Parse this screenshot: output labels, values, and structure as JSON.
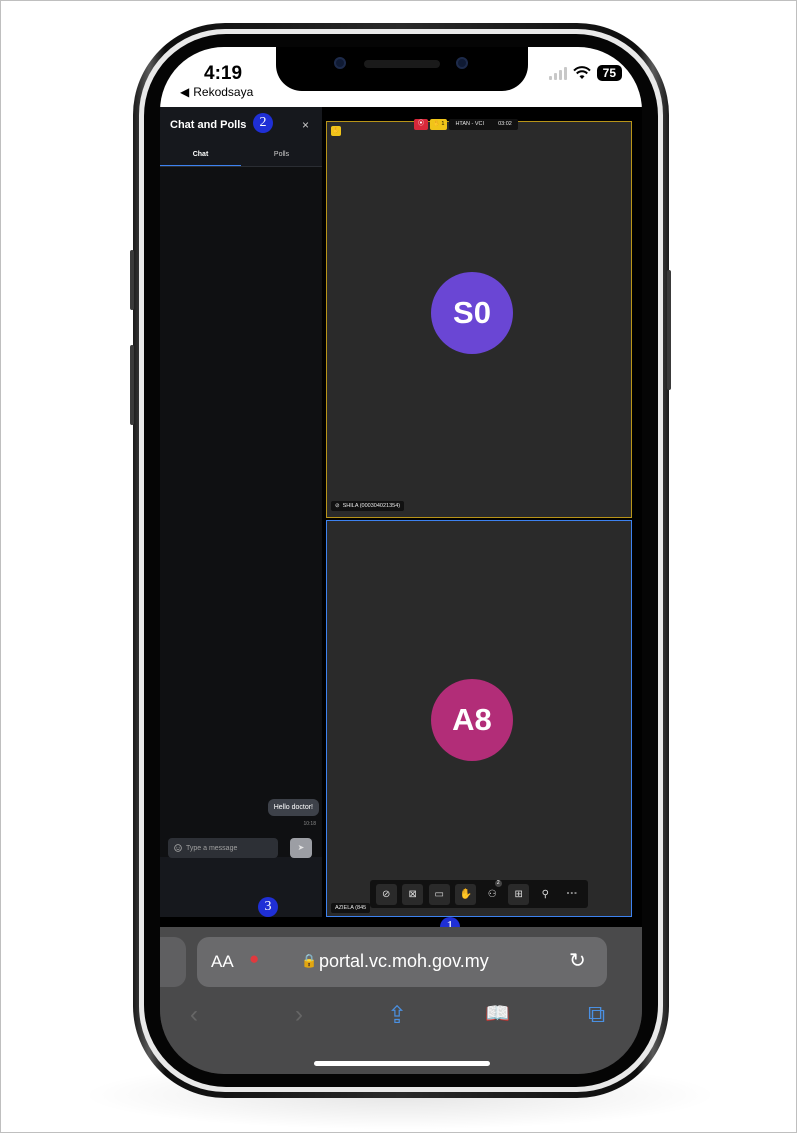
{
  "status_bar": {
    "time": "4:19",
    "back_label": "Rekodsaya",
    "back_arrow": "◀",
    "battery": "75"
  },
  "chat_panel": {
    "title": "Chat and Polls",
    "close_symbol": "×",
    "tabs": [
      {
        "label": "Chat",
        "active": true
      },
      {
        "label": "Polls",
        "active": false
      }
    ],
    "messages": [
      {
        "text": "Hello doctor!",
        "time": "10:18"
      }
    ],
    "input_placeholder": "Type a message",
    "send_symbol": "➤"
  },
  "meeting": {
    "rec_symbol": "⦿",
    "hand_count": "✋ 1",
    "meeting_name": "HTAN - VCI",
    "duration": "03:02",
    "participants": [
      {
        "initials": "S0",
        "name": "SHILA (000304021354)",
        "avatar_color": "#6a46d4",
        "hand_raised": true,
        "muted": true
      },
      {
        "initials": "A8",
        "name": "AZIELA (845",
        "avatar_color": "#b22d78",
        "hand_raised": false,
        "muted": false
      }
    ],
    "participant_count": "2"
  },
  "toolbar": {
    "items": [
      {
        "icon": "mic-off-icon",
        "glyph": "⊘",
        "highlighted": true
      },
      {
        "icon": "camera-off-icon",
        "glyph": "⊠",
        "highlighted": true
      },
      {
        "icon": "chat-icon",
        "glyph": "▭",
        "highlighted": true
      },
      {
        "icon": "raise-hand-icon",
        "glyph": "✋",
        "highlighted": true
      },
      {
        "icon": "participants-icon",
        "glyph": "⚇",
        "highlighted": false
      },
      {
        "icon": "layout-grid-icon",
        "glyph": "⊞",
        "highlighted": true
      },
      {
        "icon": "invite-icon",
        "glyph": "⚲",
        "highlighted": false
      },
      {
        "icon": "more-icon",
        "glyph": "∘∘∘",
        "highlighted": false
      }
    ]
  },
  "markers": [
    "1",
    "2",
    "3"
  ],
  "browser": {
    "aa_label": "AA",
    "mic_glyph": "●",
    "lock_glyph": "🔒",
    "url": "portal.vc.moh.gov.my",
    "reload_glyph": "↻",
    "back_glyph": "‹",
    "forward_glyph": "›",
    "share_glyph": "⇪",
    "bookmarks_glyph": "📖",
    "tabs_glyph": "⧉"
  }
}
